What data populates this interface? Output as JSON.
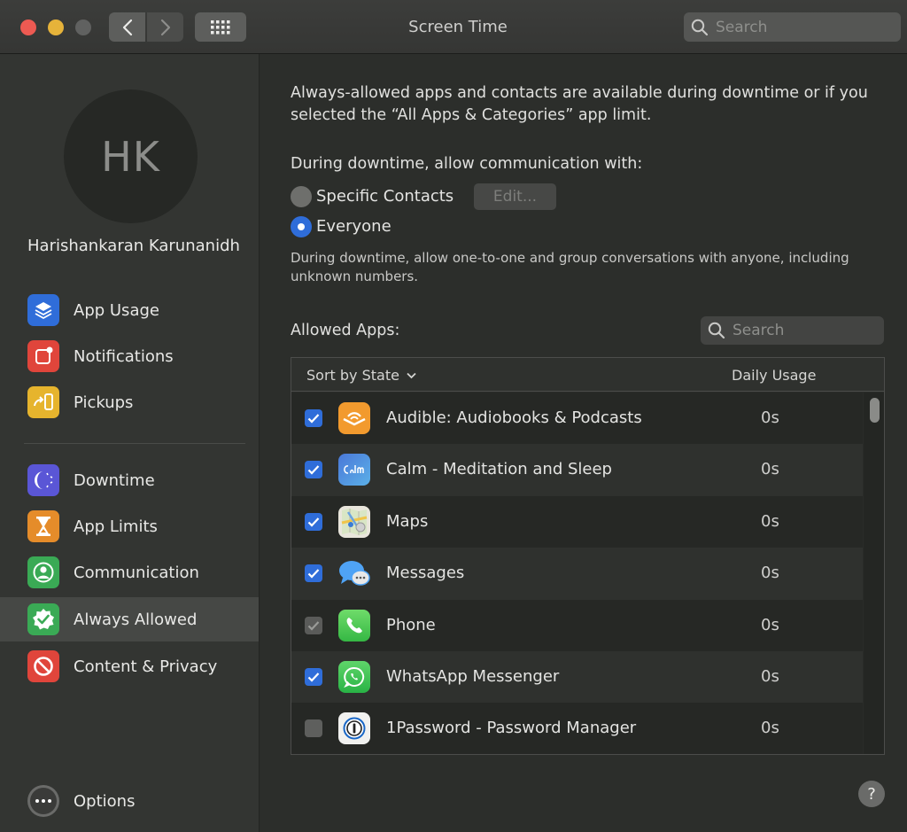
{
  "window": {
    "title": "Screen Time",
    "search_placeholder": "Search"
  },
  "sidebar": {
    "avatar_initials": "HK",
    "user_name": "Harishankaran Karunanidh",
    "items": [
      {
        "label": "App Usage",
        "icon": "layers-icon",
        "color": "#2f6dd9"
      },
      {
        "label": "Notifications",
        "icon": "notification-badge-icon",
        "color": "#e0453b"
      },
      {
        "label": "Pickups",
        "icon": "pickup-phone-icon",
        "color": "#e6b42d"
      },
      {
        "label": "Downtime",
        "icon": "moon-clock-icon",
        "color": "#5a56d6"
      },
      {
        "label": "App Limits",
        "icon": "hourglass-icon",
        "color": "#e58c2a"
      },
      {
        "label": "Communication",
        "icon": "person-circle-icon",
        "color": "#3aaa55"
      },
      {
        "label": "Always Allowed",
        "icon": "checkmark-seal-icon",
        "color": "#3aaa55",
        "selected": true
      },
      {
        "label": "Content & Privacy",
        "icon": "prohibited-icon",
        "color": "#e0453b"
      }
    ],
    "options_label": "Options"
  },
  "main": {
    "intro": "Always-allowed apps and contacts are available during downtime or if you selected the “All Apps & Categories” app limit.",
    "downtime_label": "During downtime, allow communication with:",
    "radio_specific": "Specific Contacts",
    "edit_button": "Edit...",
    "radio_everyone": "Everyone",
    "selected_radio": "Everyone",
    "note": "During downtime, allow one-to-one and group conversations with anyone, including unknown numbers.",
    "allowed_apps_label": "Allowed Apps:",
    "apps_search_placeholder": "Search",
    "sort_label": "Sort by State",
    "usage_header": "Daily Usage",
    "apps": [
      {
        "name": "Audible: Audiobooks & Podcasts",
        "usage": "0s",
        "state": "checked",
        "icon": "audible-icon"
      },
      {
        "name": "Calm - Meditation and Sleep",
        "usage": "0s",
        "state": "checked",
        "icon": "calm-icon"
      },
      {
        "name": "Maps",
        "usage": "0s",
        "state": "checked",
        "icon": "maps-icon"
      },
      {
        "name": "Messages",
        "usage": "0s",
        "state": "checked",
        "icon": "messages-icon"
      },
      {
        "name": "Phone",
        "usage": "0s",
        "state": "locked",
        "icon": "phone-icon"
      },
      {
        "name": "WhatsApp Messenger",
        "usage": "0s",
        "state": "checked",
        "icon": "whatsapp-icon"
      },
      {
        "name": "1Password - Password Manager",
        "usage": "0s",
        "state": "unchecked",
        "icon": "onepassword-icon"
      }
    ],
    "help_label": "?"
  }
}
